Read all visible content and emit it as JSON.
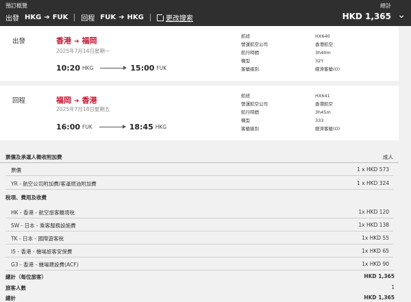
{
  "header": {
    "summary_label": "預訂概覽",
    "outbound_label": "出發",
    "outbound_from": "HKG",
    "outbound_to": "FUK",
    "return_label": "回程",
    "return_from": "FUK",
    "return_to": "HKG",
    "edit_label": "更改搜索",
    "total_label": "總計",
    "total_amount": "HKD 1,365"
  },
  "flights": [
    {
      "direction": "出發",
      "from_city": "香港",
      "to_city": "福岡",
      "date": "2025年7月14日星期一",
      "dep_time": "10:20",
      "dep_code": "HKG",
      "arr_time": "15:00",
      "arr_code": "FUK",
      "details": [
        {
          "label": "航班",
          "value": "HX640"
        },
        {
          "label": "營運航空公司",
          "value": "香港航空"
        },
        {
          "label": "航行時間",
          "value": "3h40m"
        },
        {
          "label": "機型",
          "value": "32Y"
        },
        {
          "label": "客艙級別",
          "value": "經濟客艙(O)"
        }
      ]
    },
    {
      "direction": "回程",
      "from_city": "福岡",
      "to_city": "香港",
      "date": "2025年7月18日星期五",
      "dep_time": "16:00",
      "dep_code": "FUK",
      "arr_time": "18:45",
      "arr_code": "HKG",
      "details": [
        {
          "label": "航班",
          "value": "HX641"
        },
        {
          "label": "營運航空公司",
          "value": "香港航空"
        },
        {
          "label": "航行時間",
          "value": "3h45m"
        },
        {
          "label": "機型",
          "value": "333"
        },
        {
          "label": "客艙級別",
          "value": "經濟客艙(O)"
        }
      ]
    }
  ],
  "fare": {
    "title": "票價及承運人徵收附加費",
    "passenger_type": "成人",
    "base_rows": [
      {
        "label": "票價",
        "value": "1 x HKD 573"
      },
      {
        "label": "YR - 航空公司附加費/客運燃油附加費",
        "value": "1 x HKD 324"
      }
    ],
    "tax_title": "稅項、費用及收費",
    "tax_rows": [
      {
        "label": "HK - 香港 - 航空旅客離境稅",
        "value": "1x HKD 120"
      },
      {
        "label": "SW - 日本 - 乘客服務設施費",
        "value": "1x HKD 138"
      },
      {
        "label": "TK - 日本 - 國際遊客稅",
        "value": "1x HKD 55"
      },
      {
        "label": "I5 - 香港 - 機場旅客安保費",
        "value": "1x HKD 65"
      },
      {
        "label": "G3 - 香港 - 機場建設費(ACF)",
        "value": "1x HKD 90"
      }
    ],
    "total_per_pax_label": "總計（每位旅客）",
    "total_per_pax_value": "HKD 1,365",
    "pax_count_label": "旅客人數",
    "pax_count_value": "1",
    "grand_total_label": "總計",
    "grand_total_value": "HKD 1,365"
  }
}
